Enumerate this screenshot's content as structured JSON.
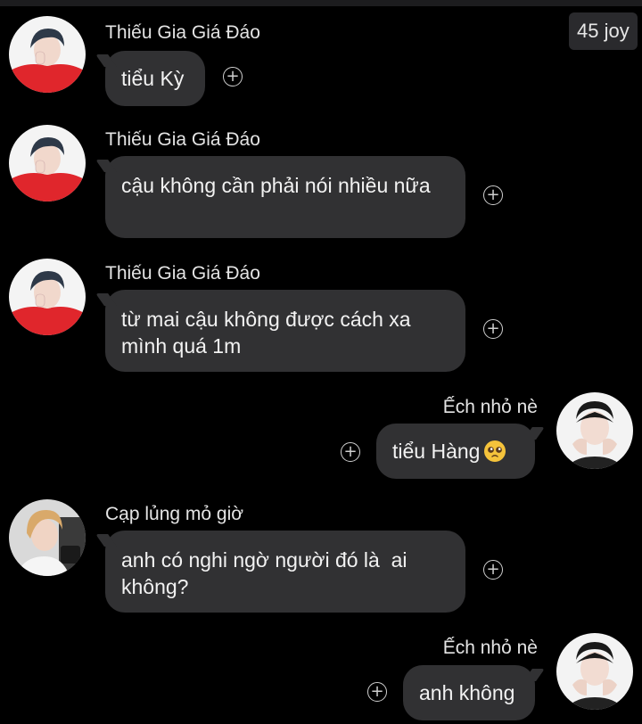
{
  "header": {
    "joy_badge": "45 joy"
  },
  "messages": [
    {
      "sender": "Thiếu Gia Giá Đáo",
      "text": "tiểu Kỳ",
      "side": "left",
      "avatar": "avatar-red-jacket"
    },
    {
      "sender": "Thiếu Gia Giá Đáo",
      "text": "cậu không cần phải nói nhiều nữa",
      "side": "left",
      "avatar": "avatar-red-jacket"
    },
    {
      "sender": "Thiếu Gia Giá Đáo",
      "text": "từ mai cậu không được cách xa mình quá 1m",
      "side": "left",
      "avatar": "avatar-red-jacket"
    },
    {
      "sender": "Ếch nhỏ nè",
      "text": "tiểu Hàng",
      "emoji": "pleading-face-emoji",
      "side": "right",
      "avatar": "avatar-hands-on-face"
    },
    {
      "sender": "Cạp lủng mỏ giờ",
      "text": "anh có nghi ngờ người đó là  ai không?",
      "side": "left",
      "avatar": "avatar-blonde"
    },
    {
      "sender": "Ếch nhỏ nè",
      "text": "anh không",
      "side": "right",
      "avatar": "avatar-hands-on-face"
    }
  ],
  "reaction_icon": "plus-circle-icon",
  "reaction_glyph": "+",
  "colors": {
    "background": "#000000",
    "bubble": "#313133",
    "text": "#f2f2f2",
    "sender_text": "#e4e4e4"
  }
}
